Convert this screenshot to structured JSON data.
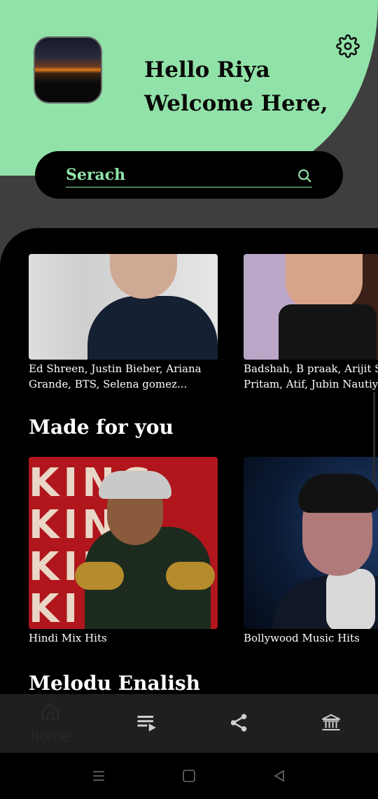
{
  "header": {
    "greeting_line1": "Hello Riya",
    "greeting_line2": "Welcome Here,",
    "settings_icon": "gear-icon",
    "bg_color": "#91e2a8"
  },
  "search": {
    "placeholder": "Serach",
    "icon": "search-icon",
    "accent_color": "#91e2a8"
  },
  "artists": [
    {
      "caption_line1": "Ed Shreen, Justin Bieber, Ariana",
      "caption_line2": "Grande, BTS, Selena gomez..."
    },
    {
      "caption_line1": "Badshah, B praak, Arijit S",
      "caption_line2": "Pritam, Atif, Jubin Nautiy"
    }
  ],
  "made_for_you": {
    "title": "Made for you",
    "cards": [
      {
        "caption": "Hindi Mix Hits",
        "cover_text": [
          "KING",
          "KING",
          "KING",
          "KING"
        ]
      },
      {
        "caption": "Bollywood Music Hits"
      }
    ]
  },
  "next_section": {
    "title": "Melodu Enalish"
  },
  "bottom_nav": {
    "items": [
      {
        "icon": "home-icon",
        "label": "home"
      },
      {
        "icon": "playlist-icon"
      },
      {
        "icon": "share-icon"
      },
      {
        "icon": "library-icon"
      }
    ]
  },
  "system_nav": {
    "items": [
      "menu-icon",
      "home-square-icon",
      "back-icon"
    ]
  }
}
